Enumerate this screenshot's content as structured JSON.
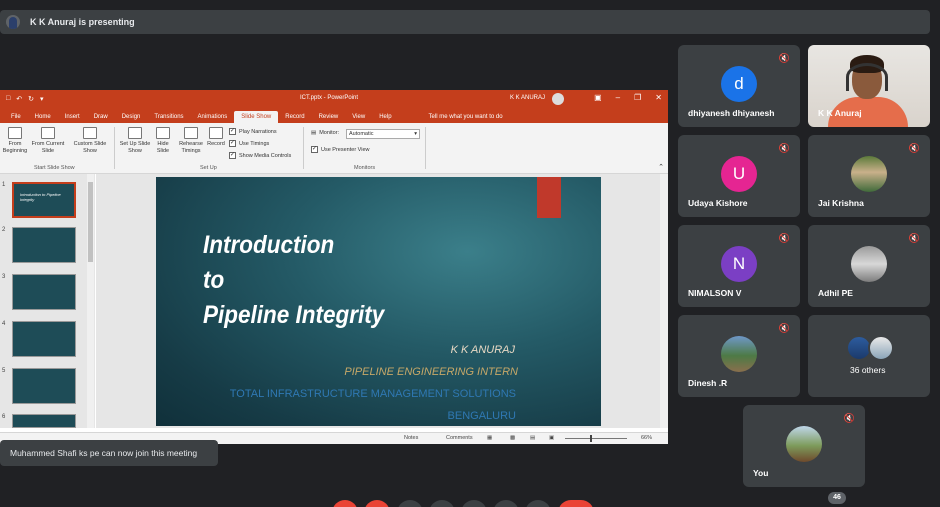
{
  "presenter": {
    "text": "K K Anuraj is presenting"
  },
  "powerpoint": {
    "doc_title": "ICT.pptx  -  PowerPoint",
    "user": "K K ANURAJ",
    "tabs": [
      "File",
      "Home",
      "Insert",
      "Draw",
      "Design",
      "Transitions",
      "Animations",
      "Slide Show",
      "Record",
      "Review",
      "View",
      "Help"
    ],
    "tell_me": "Tell me what you want to do",
    "ribbon": {
      "from_beginning": "From Beginning",
      "from_current": "From Current Slide",
      "custom_show": "Custom Slide Show",
      "start_group": "Start Slide Show",
      "set_up_show": "Set Up Slide Show",
      "hide_slide": "Hide Slide",
      "rehearse": "Rehearse Timings",
      "record": "Record",
      "play_narrations": "Play Narrations",
      "use_timings": "Use Timings",
      "show_media": "Show Media Controls",
      "setup_group": "Set Up",
      "monitor_label": "Monitor:",
      "monitor_value": "Automatic",
      "presenter_view": "Use Presenter View",
      "monitors_group": "Monitors"
    },
    "thumbnails": [
      {
        "num": "1",
        "text": "Introduction to Pipeline Integrity"
      },
      {
        "num": "2",
        "text": ""
      },
      {
        "num": "3",
        "text": ""
      },
      {
        "num": "4",
        "text": ""
      },
      {
        "num": "5",
        "text": ""
      },
      {
        "num": "6",
        "text": ""
      }
    ],
    "slide": {
      "title_line1": "Introduction",
      "title_line2": "to",
      "title_line3": "Pipeline Integrity",
      "author": "K K ANURAJ",
      "role": "PIPELINE ENGINEERING INTERN",
      "company": "TOTAL INFRASTRUCTURE MANAGEMENT SOLUTIONS",
      "city": "BENGALURU"
    },
    "status": {
      "notes": "Notes",
      "comments": "Comments",
      "zoom": "66%"
    }
  },
  "participants": [
    {
      "name": "dhiyanesh dhiyanesh",
      "letter": "d",
      "color": "#1a73e8"
    },
    {
      "name": "K K Anuraj"
    },
    {
      "name": "Udaya Kishore",
      "letter": "U",
      "color": "#e52592"
    },
    {
      "name": "Jai Krishna"
    },
    {
      "name": "NIMALSON V",
      "letter": "N",
      "color": "#7b3fc4"
    },
    {
      "name": "Adhil PE"
    },
    {
      "name": "Dinesh .R"
    },
    {
      "name": "36 others"
    }
  ],
  "self_tile": {
    "name": "You"
  },
  "toast": {
    "text": "Muhammed Shafi ks pe can now join this meeting"
  },
  "participant_count": "46",
  "icons": {
    "mute": "mic-off-icon"
  }
}
